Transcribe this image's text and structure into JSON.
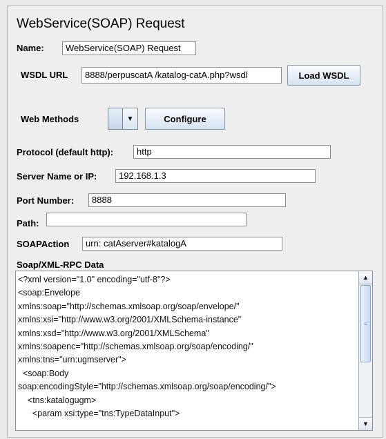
{
  "title": "WebService(SOAP) Request",
  "name": {
    "label": "Name:",
    "value": "WebService(SOAP) Request"
  },
  "wsdl": {
    "label": "WSDL URL",
    "value": "8888/perpuscatA /katalog-catA.php?wsdl",
    "button": "Load WSDL"
  },
  "web_methods": {
    "label": "Web Methods",
    "button": "Configure"
  },
  "protocol": {
    "label": "Protocol (default http):",
    "value": "http"
  },
  "server": {
    "label": "Server Name or IP:",
    "value": "192.168.1.3"
  },
  "port": {
    "label": "Port Number:",
    "value": "8888"
  },
  "path": {
    "label": "Path:",
    "value": ""
  },
  "soap_action": {
    "label": "SOAPAction",
    "value": "urn: catAserver#katalogA"
  },
  "soap_data": {
    "label": "Soap/XML-RPC Data",
    "lines": [
      "<?xml version=\"1.0\" encoding=\"utf-8\"?>",
      "<soap:Envelope",
      "xmlns:soap=\"http://schemas.xmlsoap.org/soap/envelope/\"",
      "xmlns:xsi=\"http://www.w3.org/2001/XMLSchema-instance\"",
      "xmlns:xsd=\"http://www.w3.org/2001/XMLSchema\"",
      "xmlns:soapenc=\"http://schemas.xmlsoap.org/soap/encoding/\"",
      "xmlns:tns=\"urn:ugmserver\">",
      "  <soap:Body",
      "soap:encodingStyle=\"http://schemas.xmlsoap.org/soap/encoding/\">",
      "    <tns:katalogugm>",
      "      <param xsi:type=\"tns:TypeDataInput\">"
    ]
  }
}
